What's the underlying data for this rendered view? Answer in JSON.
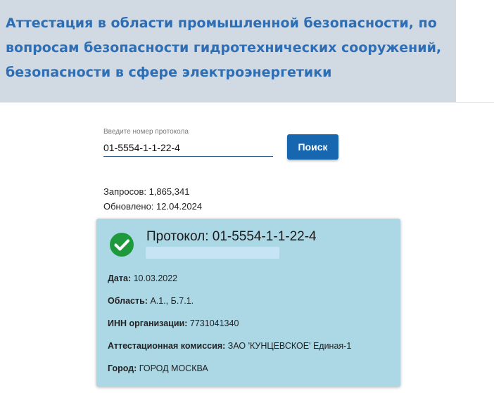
{
  "header": {
    "title": "Аттестация в области промышленной безопасности, по вопросам безопасности гидротехнических сооружений, безопасности в сфере электроэнергетики"
  },
  "search": {
    "label": "Введите номер протокола",
    "value": "01-5554-1-1-22-4",
    "button_label": "Поиск"
  },
  "stats": {
    "requests": "Запросов: 1,865,341",
    "updated": "Обновлено: 12.04.2024"
  },
  "result": {
    "title": "Протокол: 01-5554-1-1-22-4",
    "status_icon": "check-circle-icon",
    "fields": [
      {
        "label": "Дата:",
        "value": "10.03.2022"
      },
      {
        "label": "Область:",
        "value": "А.1., Б.7.1."
      },
      {
        "label": "ИНН организации:",
        "value": "7731041340"
      },
      {
        "label": "Аттестационная комиссия:",
        "value": "ЗАО 'КУНЦЕВСКОЕ' Единая-1"
      },
      {
        "label": "Город:",
        "value": "ГОРОД МОСКВА"
      }
    ]
  },
  "colors": {
    "header_bg": "#d1d9e3",
    "header_text": "#2e6eb5",
    "button_bg": "#1767b0",
    "card_bg": "#acd8e6",
    "success": "#1e9a3c"
  }
}
